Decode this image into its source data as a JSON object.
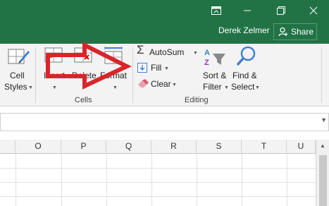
{
  "titlebar": {
    "user_name": "Derek Zelmer",
    "share_label": "Share"
  },
  "ribbon": {
    "styles": {
      "cell_line1": "Cell",
      "cell_line2": "Styles"
    },
    "cells": {
      "label": "Cells",
      "insert": "Insert",
      "delete": "Delete",
      "format": "Format"
    },
    "editing": {
      "label": "Editing",
      "autosum": "AutoSum",
      "fill": "Fill",
      "clear": "Clear",
      "sort_line1": "Sort &",
      "sort_line2": "Filter",
      "find_line1": "Find &",
      "find_line2": "Select"
    }
  },
  "grid": {
    "columns": [
      "O",
      "P",
      "Q",
      "R",
      "S",
      "T",
      "U"
    ]
  },
  "colors": {
    "excel_green": "#217346",
    "annotation_red": "#d9252a"
  },
  "annotation": "red-arrow-pointing-to-fill"
}
